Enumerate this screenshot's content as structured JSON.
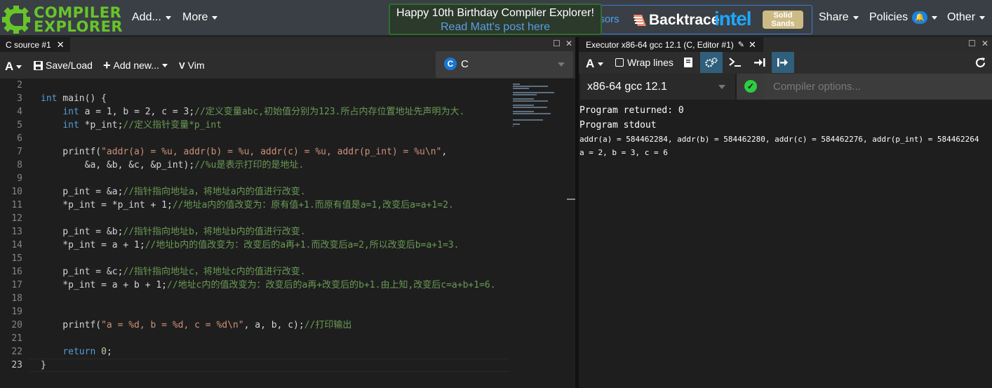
{
  "nav": {
    "logo_line1": "COMPILER",
    "logo_line2": "EXPLORER",
    "add": "Add...",
    "more": "More",
    "banner_title": "Happy 10th Birthday Compiler Explorer!",
    "banner_link": "Read Matt's post here",
    "sponsors_label": "nsors",
    "sponsor_backtrace": "Backtrace",
    "sponsor_intel": "intel",
    "sponsor_solid_line1": "Solid",
    "sponsor_solid_line2": "Sands",
    "share": "Share",
    "policies": "Policies",
    "other": "Other"
  },
  "source": {
    "tab_title": "C source #1",
    "save_load": "Save/Load",
    "add_new": "Add new...",
    "vim": "Vim",
    "language": "C",
    "line_numbers": [
      "2",
      "3",
      "4",
      "5",
      "6",
      "7",
      "8",
      "9",
      "10",
      "11",
      "12",
      "13",
      "14",
      "15",
      "16",
      "17",
      "18",
      "19",
      "20",
      "21",
      "22",
      "23"
    ],
    "lines": [
      {
        "t": ""
      },
      {
        "kw": "int",
        "rest": " main() {"
      },
      {
        "pre": "    ",
        "kw": "int",
        "rest": " a = 1, b = 2, c = 3;",
        "cm": "//定义变量abc,初始值分别为123.所占内存位置地址先声明为大."
      },
      {
        "pre": "    ",
        "kw": "int",
        "rest": " *p_int;",
        "cm": "//定义指针变量*p_int"
      },
      {
        "t": ""
      },
      {
        "pre": "    printf(",
        "str": "\"addr(a) = %u, addr(b) = %u, addr(c) = %u, addr(p_int) = %u\\n\"",
        "rest": ","
      },
      {
        "pre": "        &a, &b, &c, &p_int);",
        "cm": "//%u是表示打印的是地址."
      },
      {
        "t": ""
      },
      {
        "pre": "    p_int = &a;",
        "cm": "//指针指向地址a，将地址a内的值进行改变."
      },
      {
        "pre": "    *p_int = *p_int + 1;",
        "cm": "//地址a内的值改变为：原有值+1.而原有值是a=1,改变后a=a+1=2."
      },
      {
        "t": ""
      },
      {
        "pre": "    p_int = &b;",
        "cm": "//指针指向地址b，将地址b内的值进行改变."
      },
      {
        "pre": "    *p_int = a + 1;",
        "cm": "//地址b内的值改变为：改变后的a再+1.而改变后a=2,所以改变后b=a+1=3."
      },
      {
        "t": ""
      },
      {
        "pre": "    p_int = &c;",
        "cm": "//指针指向地址c，将地址c内的值进行改变."
      },
      {
        "pre": "    *p_int = a + b + 1;",
        "cm": "//地址c内的值改变为：改变后的a再+改变后的b+1.由上知,改变后c=a+b+1=6."
      },
      {
        "t": ""
      },
      {
        "t": ""
      },
      {
        "pre": "    printf(",
        "str": "\"a = %d, b = %d, c = %d\\n\"",
        "rest": ", a, b, c);",
        "cm": "//打印输出"
      },
      {
        "t": ""
      },
      {
        "pre": "    ",
        "kw": "return",
        "rest": " ",
        "num": "0",
        "rest2": ";"
      },
      {
        "t": "}"
      }
    ]
  },
  "executor": {
    "tab_title": "Executor x86-64 gcc 12.1 (C, Editor #1)",
    "wrap_lines": "Wrap lines",
    "compiler": "x86-64 gcc 12.1",
    "options_placeholder": "Compiler options...",
    "returned": "Program returned: 0",
    "stdout_label": "Program stdout",
    "stdout_lines": [
      "addr(a) = 584462284, addr(b) = 584462280, addr(c) = 584462276, addr(p_int) = 584462264",
      "a = 2, b = 3, c = 6"
    ]
  },
  "colors": {
    "accent_green": "#67c52a",
    "brand_blue": "#1a82e2"
  }
}
